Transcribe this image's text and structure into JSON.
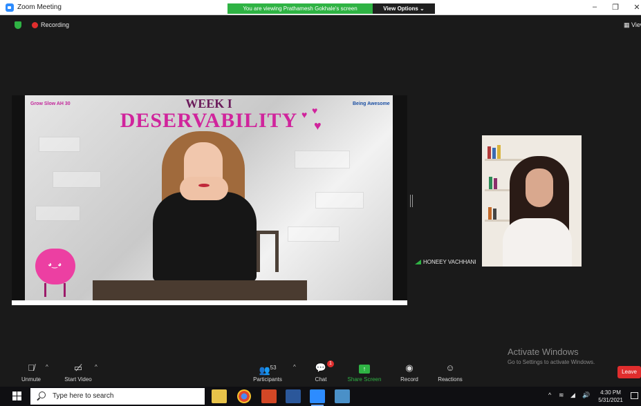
{
  "window": {
    "title": "Zoom Meeting",
    "viewing_banner": "You are viewing Prathamesh Gokhale's screen",
    "view_options": "View Options ⌄"
  },
  "meeting_bar": {
    "recording_label": "Recording",
    "view_label": "▦ View"
  },
  "slide": {
    "week": "WEEK I",
    "title": "DESERVABILITY",
    "logo_left": "Grow Slow AH 30",
    "logo_right": "Being Awesome"
  },
  "participant": {
    "name": "HONEEY VACHHANI"
  },
  "watermark": {
    "title": "Activate Windows",
    "subtitle": "Go to Settings to activate Windows."
  },
  "toolbar": {
    "unmute": "Unmute",
    "start_video": "Start Video",
    "participants": "Participants",
    "participants_count": "53",
    "chat": "Chat",
    "chat_badge": "1",
    "share_screen": "Share Screen",
    "record": "Record",
    "reactions": "Reactions",
    "leave": "Leave"
  },
  "taskbar": {
    "search_placeholder": "Type here to search",
    "time": "4:30 PM",
    "date": "5/31/2021"
  }
}
